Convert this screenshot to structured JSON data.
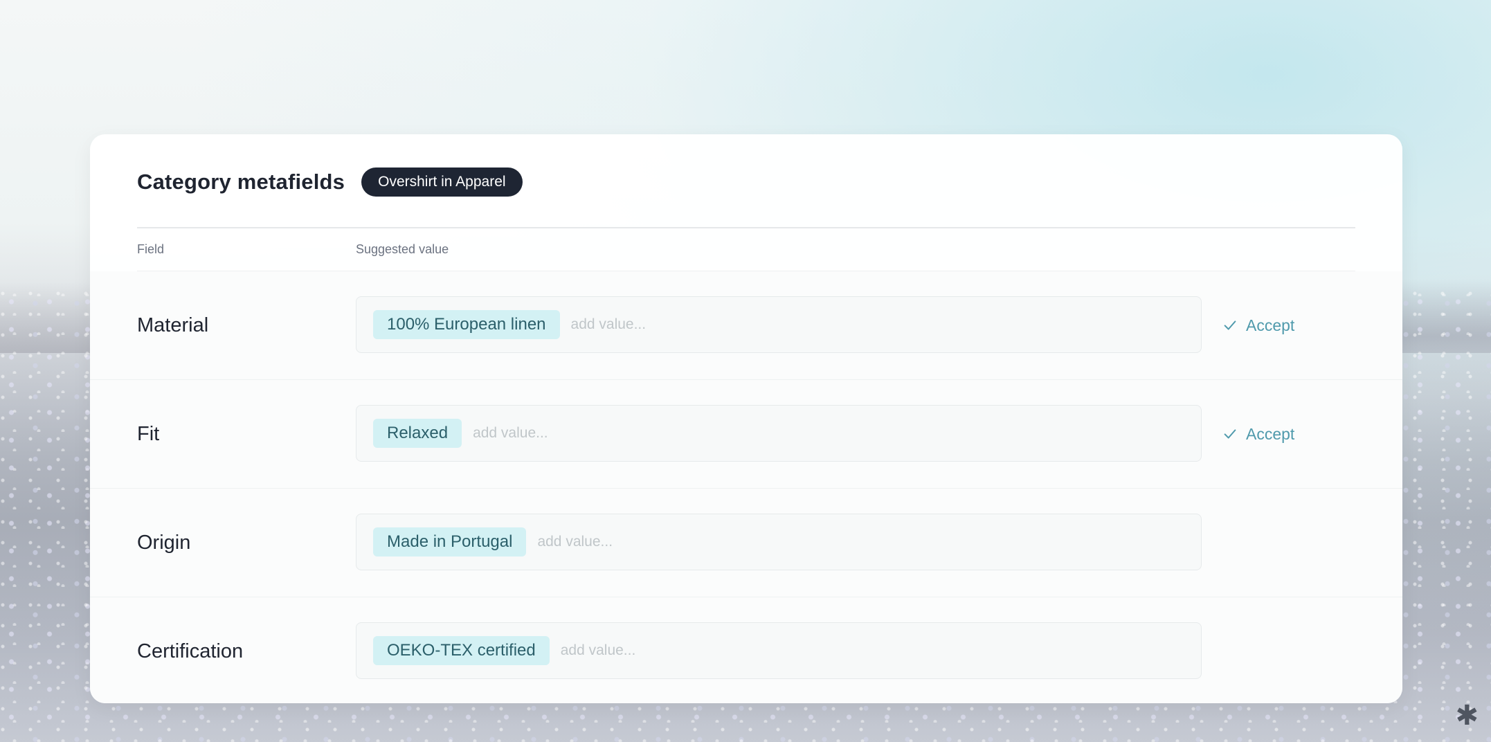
{
  "header": {
    "title": "Category metafields",
    "badge": "Overshirt in Apparel"
  },
  "columns": {
    "field": "Field",
    "suggested": "Suggested value"
  },
  "rows": [
    {
      "field": "Material",
      "value": "100% European linen",
      "placeholder": "add value...",
      "accept_label": "Accept"
    },
    {
      "field": "Fit",
      "value": "Relaxed",
      "placeholder": "add value...",
      "accept_label": "Accept"
    },
    {
      "field": "Origin",
      "value": "Made in Portugal",
      "placeholder": "add value..."
    },
    {
      "field": "Certification",
      "value": "OEKO-TEX certified",
      "placeholder": "add value..."
    }
  ],
  "colors": {
    "badge_bg": "#1e2533",
    "chip_bg": "#d3f1f4",
    "accent": "#4f9aac"
  },
  "icons": {
    "accept": "check-icon",
    "corner": "asterisk-icon"
  },
  "corner_glyph": "✱"
}
